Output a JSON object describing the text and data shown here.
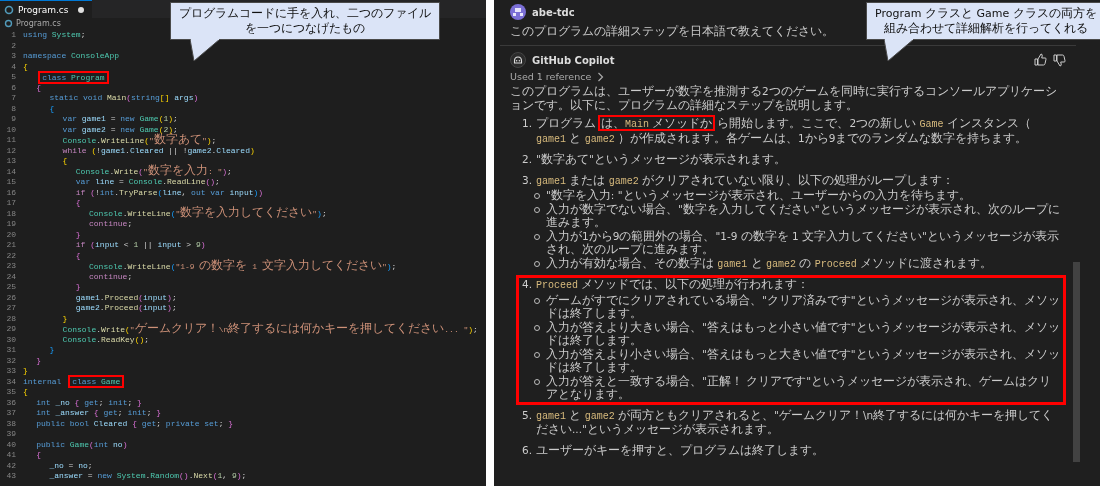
{
  "editor": {
    "tab": {
      "label": "Program.cs",
      "modified": true
    },
    "breadcrumb": "Program.cs",
    "callout": {
      "lines": [
        "プログラムコードに手を入れ、二つのファイル",
        "を一つにつなげたもの"
      ]
    },
    "lines": [
      {
        "n": "1",
        "tokens": [
          {
            "kind": "kw",
            "text": "using "
          },
          {
            "kind": "ty",
            "text": "System"
          },
          {
            "kind": "p",
            "text": ";"
          }
        ]
      },
      {
        "n": "2"
      },
      {
        "n": "3",
        "tokens": [
          {
            "kind": "kw",
            "text": "namespace "
          },
          {
            "kind": "ty",
            "text": "ConsoleApp"
          }
        ]
      },
      {
        "n": "4",
        "tokens": [
          {
            "kind": "br",
            "text": "{"
          }
        ]
      },
      {
        "n": "5",
        "tokens": [
          {
            "kind": "kw",
            "text": "    class ",
            "highlight": true
          },
          {
            "kind": "ty",
            "text": "Program",
            "highlight": true
          }
        ]
      },
      {
        "n": "6",
        "tokens": [
          {
            "kind": "pa",
            "text": "    {"
          }
        ]
      },
      {
        "n": "7",
        "tokens": [
          {
            "kind": "kw",
            "text": "        static void "
          },
          {
            "kind": "fn",
            "text": "Main"
          },
          {
            "kind": "pa",
            "text": "("
          },
          {
            "kind": "kw",
            "text": "string"
          },
          {
            "kind": "br",
            "text": "[]"
          },
          {
            "kind": "va",
            "text": " args"
          },
          {
            "kind": "pa",
            "text": ")"
          }
        ]
      },
      {
        "n": "8",
        "tokens": [
          {
            "kind": "pb",
            "text": "        {"
          }
        ]
      },
      {
        "n": "9",
        "tokens": [
          {
            "kind": "kw",
            "text": "            var "
          },
          {
            "kind": "va",
            "text": "game1"
          },
          {
            "kind": "p",
            "text": " = "
          },
          {
            "kind": "kw",
            "text": "new "
          },
          {
            "kind": "ty",
            "text": "Game"
          },
          {
            "kind": "br",
            "text": "("
          },
          {
            "kind": "nu",
            "text": "1"
          },
          {
            "kind": "br",
            "text": ")"
          },
          {
            "kind": "p",
            "text": ";"
          }
        ]
      },
      {
        "n": "10",
        "tokens": [
          {
            "kind": "kw",
            "text": "            var "
          },
          {
            "kind": "va",
            "text": "game2"
          },
          {
            "kind": "p",
            "text": " = "
          },
          {
            "kind": "kw",
            "text": "new "
          },
          {
            "kind": "ty",
            "text": "Game"
          },
          {
            "kind": "br",
            "text": "("
          },
          {
            "kind": "nu",
            "text": "2"
          },
          {
            "kind": "br",
            "text": ")"
          },
          {
            "kind": "p",
            "text": ";"
          }
        ]
      },
      {
        "n": "11",
        "tokens": [
          {
            "kind": "ty",
            "text": "            Console"
          },
          {
            "kind": "p",
            "text": "."
          },
          {
            "kind": "fn",
            "text": "WriteLine"
          },
          {
            "kind": "br",
            "text": "("
          },
          {
            "kind": "st",
            "text": "\"数字あて\""
          },
          {
            "kind": "br",
            "text": ")"
          },
          {
            "kind": "p",
            "text": ";"
          }
        ]
      },
      {
        "n": "12",
        "tokens": [
          {
            "kind": "ct",
            "text": "            while "
          },
          {
            "kind": "br",
            "text": "("
          },
          {
            "kind": "p",
            "text": "!"
          },
          {
            "kind": "va",
            "text": "game1"
          },
          {
            "kind": "p",
            "text": "."
          },
          {
            "kind": "va",
            "text": "Cleared"
          },
          {
            "kind": "p",
            "text": " || !"
          },
          {
            "kind": "va",
            "text": "game2"
          },
          {
            "kind": "p",
            "text": "."
          },
          {
            "kind": "va",
            "text": "Cleared"
          },
          {
            "kind": "br",
            "text": ")"
          }
        ]
      },
      {
        "n": "13",
        "tokens": [
          {
            "kind": "br",
            "text": "            {"
          }
        ]
      },
      {
        "n": "14",
        "tokens": [
          {
            "kind": "ty",
            "text": "                Console"
          },
          {
            "kind": "p",
            "text": "."
          },
          {
            "kind": "fn",
            "text": "Write"
          },
          {
            "kind": "pa",
            "text": "("
          },
          {
            "kind": "st",
            "text": "\"数字を入力: \""
          },
          {
            "kind": "pa",
            "text": ")"
          },
          {
            "kind": "p",
            "text": ";"
          }
        ]
      },
      {
        "n": "15",
        "tokens": [
          {
            "kind": "kw",
            "text": "                var "
          },
          {
            "kind": "va",
            "text": "line"
          },
          {
            "kind": "p",
            "text": " = "
          },
          {
            "kind": "ty",
            "text": "Console"
          },
          {
            "kind": "p",
            "text": "."
          },
          {
            "kind": "fn",
            "text": "ReadLine"
          },
          {
            "kind": "pa",
            "text": "()"
          },
          {
            "kind": "p",
            "text": ";"
          }
        ]
      },
      {
        "n": "16",
        "tokens": [
          {
            "kind": "ct",
            "text": "                if "
          },
          {
            "kind": "pa",
            "text": "("
          },
          {
            "kind": "p",
            "text": "!"
          },
          {
            "kind": "kw",
            "text": "int"
          },
          {
            "kind": "p",
            "text": "."
          },
          {
            "kind": "fn",
            "text": "TryParse"
          },
          {
            "kind": "pb",
            "text": "("
          },
          {
            "kind": "va",
            "text": "line"
          },
          {
            "kind": "p",
            "text": ", "
          },
          {
            "kind": "kw",
            "text": "out var "
          },
          {
            "kind": "va",
            "text": "input"
          },
          {
            "kind": "pb",
            "text": ")"
          },
          {
            "kind": "pa",
            "text": ")"
          }
        ]
      },
      {
        "n": "17",
        "tokens": [
          {
            "kind": "pa",
            "text": "                {"
          }
        ]
      },
      {
        "n": "18",
        "tokens": [
          {
            "kind": "ty",
            "text": "                    Console"
          },
          {
            "kind": "p",
            "text": "."
          },
          {
            "kind": "fn",
            "text": "WriteLine"
          },
          {
            "kind": "pb",
            "text": "("
          },
          {
            "kind": "st",
            "text": "\"数字を入力してください\""
          },
          {
            "kind": "pb",
            "text": ")"
          },
          {
            "kind": "p",
            "text": ";"
          }
        ]
      },
      {
        "n": "19",
        "tokens": [
          {
            "kind": "ct",
            "text": "                    continue"
          },
          {
            "kind": "p",
            "text": ";"
          }
        ]
      },
      {
        "n": "20",
        "tokens": [
          {
            "kind": "pa",
            "text": "                }"
          }
        ]
      },
      {
        "n": "21",
        "tokens": [
          {
            "kind": "ct",
            "text": "                if "
          },
          {
            "kind": "pa",
            "text": "("
          },
          {
            "kind": "va",
            "text": "input"
          },
          {
            "kind": "p",
            "text": " < "
          },
          {
            "kind": "nu",
            "text": "1"
          },
          {
            "kind": "p",
            "text": " || "
          },
          {
            "kind": "va",
            "text": "input"
          },
          {
            "kind": "p",
            "text": " > "
          },
          {
            "kind": "nu",
            "text": "9"
          },
          {
            "kind": "pa",
            "text": ")"
          }
        ]
      },
      {
        "n": "22",
        "tokens": [
          {
            "kind": "pa",
            "text": "                {"
          }
        ]
      },
      {
        "n": "23",
        "tokens": [
          {
            "kind": "ty",
            "text": "                    Console"
          },
          {
            "kind": "p",
            "text": "."
          },
          {
            "kind": "fn",
            "text": "WriteLine"
          },
          {
            "kind": "pb",
            "text": "("
          },
          {
            "kind": "st",
            "text": "\"1-9 の数字を 1 文字入力してください\""
          },
          {
            "kind": "pb",
            "text": ")"
          },
          {
            "kind": "p",
            "text": ";"
          }
        ]
      },
      {
        "n": "24",
        "tokens": [
          {
            "kind": "ct",
            "text": "                    continue"
          },
          {
            "kind": "p",
            "text": ";"
          }
        ]
      },
      {
        "n": "25",
        "tokens": [
          {
            "kind": "pa",
            "text": "                }"
          }
        ]
      },
      {
        "n": "26",
        "tokens": [
          {
            "kind": "va",
            "text": "                game1"
          },
          {
            "kind": "p",
            "text": "."
          },
          {
            "kind": "fn",
            "text": "Proceed"
          },
          {
            "kind": "pa",
            "text": "("
          },
          {
            "kind": "va",
            "text": "input"
          },
          {
            "kind": "pa",
            "text": ")"
          },
          {
            "kind": "p",
            "text": ";"
          }
        ]
      },
      {
        "n": "27",
        "tokens": [
          {
            "kind": "va",
            "text": "                game2"
          },
          {
            "kind": "p",
            "text": "."
          },
          {
            "kind": "fn",
            "text": "Proceed"
          },
          {
            "kind": "pa",
            "text": "("
          },
          {
            "kind": "va",
            "text": "input"
          },
          {
            "kind": "pa",
            "text": ")"
          },
          {
            "kind": "p",
            "text": ";"
          }
        ]
      },
      {
        "n": "28",
        "tokens": [
          {
            "kind": "br",
            "text": "            }"
          }
        ]
      },
      {
        "n": "29",
        "tokens": [
          {
            "kind": "ty",
            "text": "            Console"
          },
          {
            "kind": "p",
            "text": "."
          },
          {
            "kind": "fn",
            "text": "Write"
          },
          {
            "kind": "br",
            "text": "("
          },
          {
            "kind": "st",
            "text": "\"ゲームクリア！\\n終了するには何かキーを押してください... \""
          },
          {
            "kind": "br",
            "text": ")"
          },
          {
            "kind": "p",
            "text": ";"
          }
        ]
      },
      {
        "n": "30",
        "tokens": [
          {
            "kind": "ty",
            "text": "            Console"
          },
          {
            "kind": "p",
            "text": "."
          },
          {
            "kind": "fn",
            "text": "ReadKey"
          },
          {
            "kind": "br",
            "text": "()"
          },
          {
            "kind": "p",
            "text": ";"
          }
        ]
      },
      {
        "n": "31",
        "tokens": [
          {
            "kind": "pb",
            "text": "        }"
          }
        ]
      },
      {
        "n": "32",
        "tokens": [
          {
            "kind": "pa",
            "text": "    }"
          }
        ]
      },
      {
        "n": "33",
        "tokens": [
          {
            "kind": "br",
            "text": "}"
          }
        ]
      },
      {
        "n": "34",
        "tokens": [
          {
            "kind": "kw",
            "text": "internal "
          },
          {
            "kind": "kw",
            "text": "class ",
            "highlight": true
          },
          {
            "kind": "ty",
            "text": "Game",
            "highlight": true
          }
        ]
      },
      {
        "n": "35",
        "tokens": [
          {
            "kind": "br",
            "text": "{"
          }
        ]
      },
      {
        "n": "36",
        "tokens": [
          {
            "kind": "kw",
            "text": "    int "
          },
          {
            "kind": "va",
            "text": "_no "
          },
          {
            "kind": "pa",
            "text": "{"
          },
          {
            "kind": "kw",
            "text": " get"
          },
          {
            "kind": "p",
            "text": "; "
          },
          {
            "kind": "kw",
            "text": "init"
          },
          {
            "kind": "p",
            "text": "; "
          },
          {
            "kind": "pa",
            "text": "}"
          }
        ]
      },
      {
        "n": "37",
        "tokens": [
          {
            "kind": "kw",
            "text": "    int "
          },
          {
            "kind": "va",
            "text": "_answer "
          },
          {
            "kind": "pa",
            "text": "{"
          },
          {
            "kind": "kw",
            "text": " get"
          },
          {
            "kind": "p",
            "text": "; "
          },
          {
            "kind": "kw",
            "text": "init"
          },
          {
            "kind": "p",
            "text": "; "
          },
          {
            "kind": "pa",
            "text": "}"
          }
        ]
      },
      {
        "n": "38",
        "tokens": [
          {
            "kind": "kw",
            "text": "    public bool "
          },
          {
            "kind": "va",
            "text": "Cleared "
          },
          {
            "kind": "pa",
            "text": "{"
          },
          {
            "kind": "kw",
            "text": " get"
          },
          {
            "kind": "p",
            "text": "; "
          },
          {
            "kind": "kw",
            "text": "private set"
          },
          {
            "kind": "p",
            "text": "; "
          },
          {
            "kind": "pa",
            "text": "}"
          }
        ]
      },
      {
        "n": "39"
      },
      {
        "n": "40",
        "tokens": [
          {
            "kind": "kw",
            "text": "    public "
          },
          {
            "kind": "ty",
            "text": "Game"
          },
          {
            "kind": "pa",
            "text": "("
          },
          {
            "kind": "kw",
            "text": "int "
          },
          {
            "kind": "va",
            "text": "no"
          },
          {
            "kind": "pa",
            "text": ")"
          }
        ]
      },
      {
        "n": "41",
        "tokens": [
          {
            "kind": "pa",
            "text": "    {"
          }
        ]
      },
      {
        "n": "42",
        "tokens": [
          {
            "kind": "va",
            "text": "        _no"
          },
          {
            "kind": "p",
            "text": " = "
          },
          {
            "kind": "va",
            "text": "no"
          },
          {
            "kind": "p",
            "text": ";"
          }
        ]
      },
      {
        "n": "43",
        "tokens": [
          {
            "kind": "va",
            "text": "        _answer"
          },
          {
            "kind": "p",
            "text": " = "
          },
          {
            "kind": "kw",
            "text": "new "
          },
          {
            "kind": "ty",
            "text": "System"
          },
          {
            "kind": "p",
            "text": "."
          },
          {
            "kind": "ty",
            "text": "Random"
          },
          {
            "kind": "pa",
            "text": "()"
          },
          {
            "kind": "p",
            "text": "."
          },
          {
            "kind": "fn",
            "text": "Next"
          },
          {
            "kind": "pa",
            "text": "("
          },
          {
            "kind": "nu",
            "text": "1"
          },
          {
            "kind": "p",
            "text": ", "
          },
          {
            "kind": "nu",
            "text": "9"
          },
          {
            "kind": "pa",
            "text": ")"
          },
          {
            "kind": "p",
            "text": ";"
          }
        ]
      }
    ]
  },
  "chat": {
    "callout": {
      "lines": [
        "Program クラスと Game クラスの両方を",
        "組み合わせて詳細解析を行ってくれる"
      ]
    },
    "user": {
      "name": "abe-tdc",
      "message": "このプログラムの詳細ステップを日本語で教えてください。"
    },
    "assistant": {
      "name": "GitHub Copilot",
      "reference": "Used 1 reference",
      "intro": [
        "このプログラムは、ユーザーが数字を推測する2つのゲームを同時に実行するコンソールアプリケーションです。以下に、プログラムの詳細なステップを説明します。"
      ],
      "steps": [
        {
          "number": "1.",
          "text": [
            "プログラム",
            {
              "highlight": [
                "は、",
                {
                  "code": "Main"
                },
                " メソッドか"
              ]
            },
            "ら開始します。ここで、2つの新しい ",
            {
              "code": "Game"
            },
            " インスタンス（ ",
            {
              "code": "game1"
            },
            " と ",
            {
              "code": "game2"
            },
            " ）が作成されます。各ゲームは、1から9までのランダムな数字を持ちます。"
          ],
          "highlighted": false
        },
        {
          "number": "2.",
          "text": [
            "\"数字あて\"というメッセージが表示されます。"
          ],
          "highlighted": false
        },
        {
          "number": "3.",
          "text": [
            {
              "code": "game1"
            },
            " または ",
            {
              "code": "game2"
            },
            " がクリアされていない限り、以下の処理がループします："
          ],
          "highlighted": false,
          "bullets": [
            [
              "\"数字を入力: \"というメッセージが表示され、ユーザーからの入力を待ちます。"
            ],
            [
              "入力が数字でない場合、\"数字を入力してください\"というメッセージが表示され、次のループに進みます。"
            ],
            [
              "入力が1から9の範囲外の場合、\"1-9 の数字を 1 文字入力してください\"というメッセージが表示され、次のループに進みます。"
            ],
            [
              "入力が有効な場合、その数字は ",
              {
                "code": "game1"
              },
              " と ",
              {
                "code": "game2"
              },
              " の ",
              {
                "code": "Proceed"
              },
              " メソッドに渡されます。"
            ]
          ]
        },
        {
          "number": "4.",
          "text": [
            {
              "code": "Proceed"
            },
            " メソッドでは、以下の処理が行われます："
          ],
          "highlighted": true,
          "bullets": [
            [
              "ゲームがすでにクリアされている場合、\"クリア済みです\"というメッセージが表示され、メソッドは終了します。"
            ],
            [
              "入力が答えより大きい場合、\"答えはもっと小さい値です\"というメッセージが表示され、メソッドは終了します。"
            ],
            [
              "入力が答えより小さい場合、\"答えはもっと大きい値です\"というメッセージが表示され、メソッドは終了します。"
            ],
            [
              "入力が答えと一致する場合、\"正解！ クリアです\"というメッセージが表示され、ゲームはクリアとなります。"
            ]
          ]
        },
        {
          "number": "5.",
          "text": [
            {
              "code": "game1"
            },
            " と ",
            {
              "code": "game2"
            },
            " が両方ともクリアされると、\"ゲームクリア！\\n終了するには何かキーを押してください...\"というメッセージが表示されます。"
          ],
          "highlighted": false
        },
        {
          "number": "6.",
          "text": [
            "ユーザーがキーを押すと、プログラムは終了します。"
          ],
          "highlighted": false
        }
      ]
    }
  }
}
